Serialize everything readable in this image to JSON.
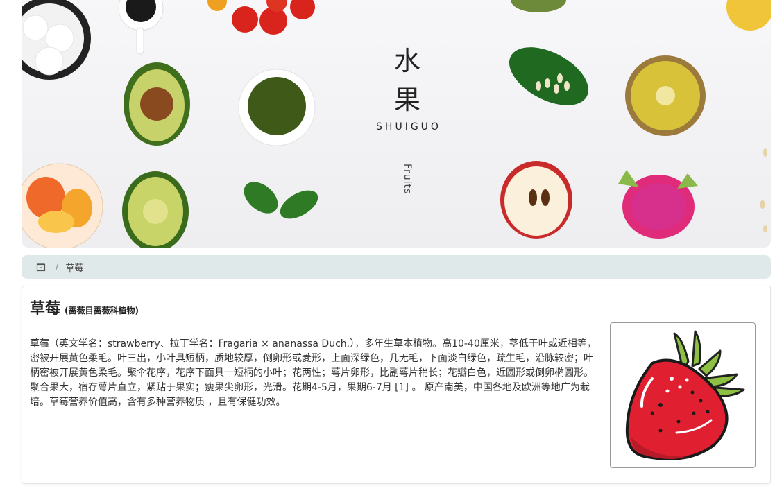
{
  "banner": {
    "title": "水果",
    "title_line1": "水",
    "title_line2": "果",
    "pinyin": "SHUIGUO",
    "english": "Fruits"
  },
  "breadcrumb": {
    "home_icon": "home-icon",
    "current": "草莓"
  },
  "article": {
    "title": "草莓",
    "subtitle": "(蔷薇目蔷薇科植物)",
    "description": "草莓（英文学名：strawberry、拉丁学名：Fragaria × ananassa Duch.），多年生草本植物。高10-40厘米，茎低于叶或近相等，密被开展黄色柔毛。叶三出，小叶具短柄，质地较厚，倒卵形或菱形，上面深绿色，几无毛，下面淡白绿色，疏生毛，沿脉较密；叶柄密被开展黄色柔毛。聚伞花序，花序下面具一短柄的小叶；花两性；萼片卵形，比副萼片稍长；花瓣白色，近圆形或倒卵椭圆形。聚合果大，宿存萼片直立，紧贴于果实；瘦果尖卵形，光滑。花期4-5月，果期6-7月 [1] 。 原产南美，中国各地及欧洲等地广为栽培。草莓营养价值高，含有多种营养物质 ，且有保健功效。",
    "image_icon": "strawberry-icon"
  },
  "colors": {
    "breadcrumb_bg": "#e0e9e9",
    "strawberry_red": "#e02030",
    "leaf_green": "#8dc043"
  }
}
